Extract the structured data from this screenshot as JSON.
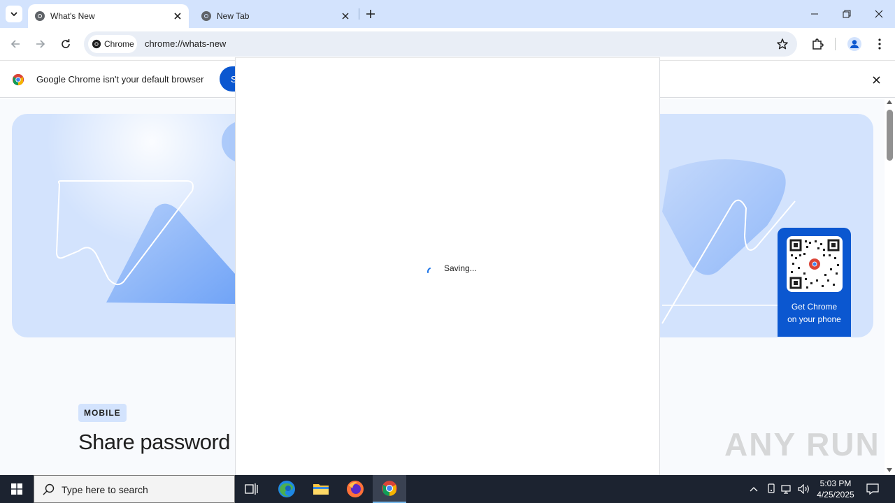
{
  "browser": {
    "tabs": [
      {
        "title": "What's New",
        "active": true
      },
      {
        "title": "New Tab",
        "active": false
      }
    ],
    "omnibox": {
      "chip": "Chrome",
      "url": "chrome://whats-new"
    }
  },
  "infobar": {
    "message": "Google Chrome isn't your default browser",
    "button_label": "S"
  },
  "content": {
    "badge": "MOBILE",
    "heading": "Share password",
    "qr_caption_line1": "Get Chrome",
    "qr_caption_line2": "on your phone",
    "watermark": "ANY RUN"
  },
  "dialog": {
    "status": "Saving..."
  },
  "taskbar": {
    "search_placeholder": "Type here to search",
    "time": "5:03 PM",
    "date": "4/25/2025"
  },
  "colors": {
    "accent": "#0b57d0",
    "tabstrip": "#d3e3fd",
    "taskbar": "#1c2330"
  }
}
